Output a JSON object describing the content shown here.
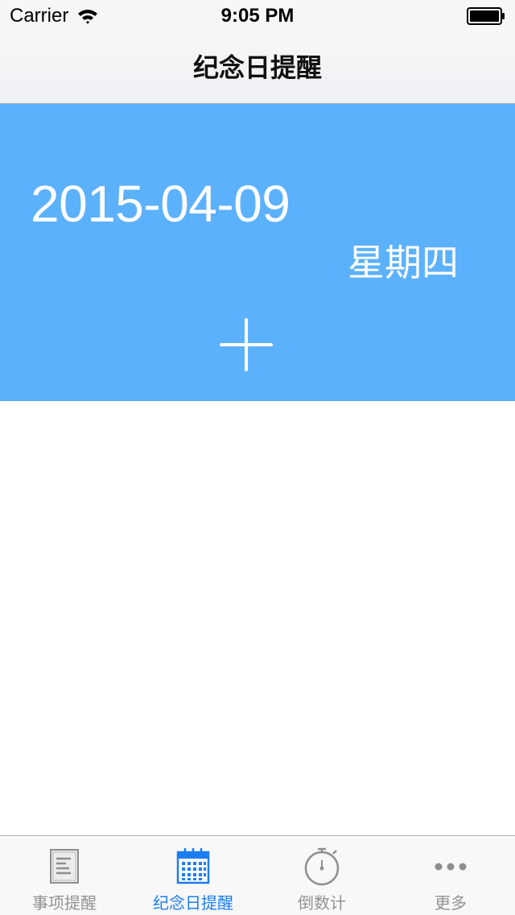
{
  "status_bar": {
    "carrier": "Carrier",
    "time": "9:05 PM",
    "wifi_icon": "wifi-icon",
    "battery_icon": "battery-icon"
  },
  "nav": {
    "title": "纪念日提醒"
  },
  "header": {
    "date": "2015-04-09",
    "weekday": "星期四",
    "add_icon": "plus-icon",
    "background_color": "#5cb1fd"
  },
  "tabs": [
    {
      "label": "事项提醒",
      "icon": "document-icon",
      "active": false
    },
    {
      "label": "纪念日提醒",
      "icon": "calendar-icon",
      "active": true
    },
    {
      "label": "倒数计",
      "icon": "stopwatch-icon",
      "active": false
    },
    {
      "label": "更多",
      "icon": "more-icon",
      "active": false
    }
  ],
  "colors": {
    "accent": "#1c7cf2",
    "inactive_tab": "#929292"
  }
}
